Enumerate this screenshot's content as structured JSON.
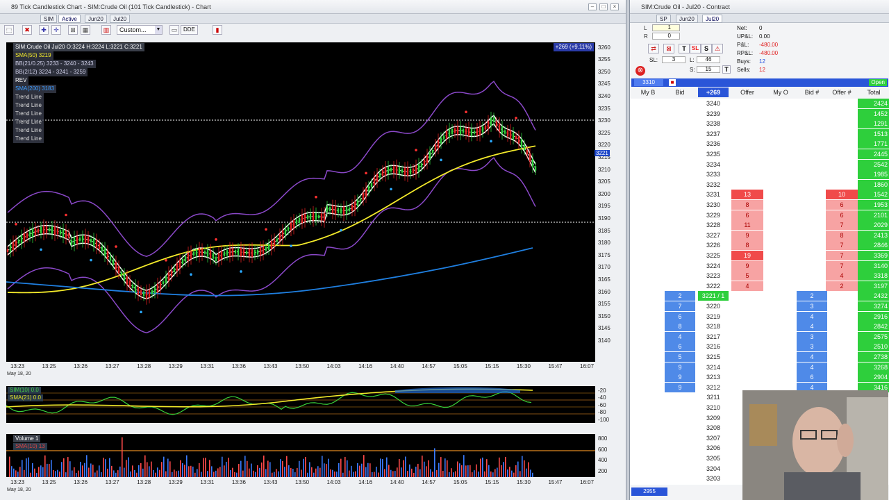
{
  "colors": {
    "bid_blue": "#5b8fe8",
    "offer_red": "#f04a4a",
    "total_green": "#2ecf3c",
    "sma_yellow": "#f3ea2a",
    "sma_blue": "#1f7fe0",
    "bb_purple": "#8a48c8"
  },
  "chart_window": {
    "title": "89 Tick Candlestick Chart - SIM:Crude Oil (101 Tick Candlestick) - Chart",
    "tabs": [
      "SIM",
      "Active",
      "Jun20",
      "Jul20"
    ],
    "toolbar_template": "Custom...",
    "toolbar_dde": "DDE",
    "header_ohlc": "SIM:Crude Oil Jul20 O:3224 H:3224 L:3221 C:3221",
    "change_badge": "+269 (+9.11%)",
    "last_price_tag": "3221",
    "indicators": [
      {
        "label": "SMA(50) 3219",
        "color": "#f3ea2a"
      },
      {
        "label": "BB(21/0.25) 3233 - 3240 - 3243",
        "color": "#cfcfe8"
      },
      {
        "label": "BB(2/12) 3224 - 3241 - 3259",
        "color": "#cfcfe8"
      },
      {
        "label": "REV",
        "color": "#ffffff"
      },
      {
        "label": "SMA(200) 3183",
        "color": "#3c9cff"
      },
      {
        "label": "Trend Line",
        "color": "#dddddd"
      },
      {
        "label": "Trend Line",
        "color": "#dddddd"
      },
      {
        "label": "Trend Line",
        "color": "#dddddd"
      },
      {
        "label": "Trend Line",
        "color": "#dddddd"
      },
      {
        "label": "Trend Line",
        "color": "#dddddd"
      },
      {
        "label": "Trend Line",
        "color": "#dddddd"
      }
    ],
    "price_axis": [
      "3260",
      "3255",
      "3250",
      "3245",
      "3240",
      "3235",
      "3230",
      "3225",
      "3220",
      "3215",
      "3210",
      "3205",
      "3200",
      "3195",
      "3190",
      "3185",
      "3180",
      "3175",
      "3170",
      "3165",
      "3160",
      "3155",
      "3150",
      "3145",
      "3140"
    ],
    "time_axis": [
      "13:23",
      "13:25",
      "13:26",
      "13:27",
      "13:28",
      "13:29",
      "13:31",
      "13:36",
      "13:43",
      "13:50",
      "14:03",
      "14:16",
      "14:40",
      "14:57",
      "15:05",
      "15:15",
      "15:30",
      "15:47",
      "16:07"
    ],
    "date_label": "May 18, 20",
    "osc_axis": [
      "-20",
      "-40",
      "-60",
      "-80",
      "-100"
    ],
    "osc_labels": [
      "SIM(10) 0.0",
      "SMA(21) 0.0"
    ],
    "volume_axis": [
      "800",
      "600",
      "400",
      "200"
    ],
    "volume_labels": [
      "Volume 1",
      "SMA(10) 13"
    ]
  },
  "dom_window": {
    "title": "SIM:Crude Oil - Jul20 - Contract",
    "tabs": [
      "SP",
      "Jun20",
      "Jul20"
    ],
    "net_label": "Net:",
    "net_value": "0",
    "upl_label": "UP&L:",
    "upl_value": "0.00",
    "pl_label": "P&L:",
    "pl_value": "-480.00",
    "rpl_label": "RP&L:",
    "rpl_value": "-480.00",
    "buys_label": "Buys:",
    "buys_value": "12",
    "sells_label": "Sells:",
    "sells_value": "12",
    "sl_label": "SL:",
    "sl_value": "3",
    "l_label": "L:",
    "l_value": "46",
    "s_label": "S:",
    "s_value": "15",
    "qty_value": "1",
    "qty2_value": "0",
    "account_box": "3310",
    "open_status": "Open",
    "bottom_box": "2955",
    "headers": {
      "my_b": "My B",
      "bid": "Bid",
      "change": "+269",
      "offer": "Offer",
      "my_o": "My O",
      "bid_n": "Bid #",
      "offer_n": "Offer #",
      "total": "Total"
    },
    "ladder": [
      {
        "price": "3240",
        "offer": "",
        "offer_n": "",
        "bid": "",
        "bid_n": "",
        "total": "2424"
      },
      {
        "price": "3239",
        "offer": "",
        "offer_n": "",
        "bid": "",
        "bid_n": "",
        "total": "1452"
      },
      {
        "price": "3238",
        "offer": "",
        "offer_n": "",
        "bid": "",
        "bid_n": "",
        "total": "1291"
      },
      {
        "price": "3237",
        "offer": "",
        "offer_n": "",
        "bid": "",
        "bid_n": "",
        "total": "1513"
      },
      {
        "price": "3236",
        "offer": "",
        "offer_n": "",
        "bid": "",
        "bid_n": "",
        "total": "1771"
      },
      {
        "price": "3235",
        "offer": "",
        "offer_n": "",
        "bid": "",
        "bid_n": "",
        "total": "2445"
      },
      {
        "price": "3234",
        "offer": "",
        "offer_n": "",
        "bid": "",
        "bid_n": "",
        "total": "2542"
      },
      {
        "price": "3233",
        "offer": "",
        "offer_n": "",
        "bid": "",
        "bid_n": "",
        "total": "1985"
      },
      {
        "price": "3232",
        "offer": "",
        "offer_n": "",
        "bid": "",
        "bid_n": "",
        "total": "1860"
      },
      {
        "price": "3231",
        "offer": "13",
        "offer_n": "10",
        "bid": "",
        "bid_n": "",
        "total": "1542"
      },
      {
        "price": "3230",
        "offer": "8",
        "offer_n": "6",
        "bid": "",
        "bid_n": "",
        "total": "1953"
      },
      {
        "price": "3229",
        "offer": "6",
        "offer_n": "6",
        "bid": "",
        "bid_n": "",
        "total": "2101"
      },
      {
        "price": "3228",
        "offer": "11",
        "offer_n": "7",
        "bid": "",
        "bid_n": "",
        "total": "2029"
      },
      {
        "price": "3227",
        "offer": "9",
        "offer_n": "8",
        "bid": "",
        "bid_n": "",
        "total": "2413"
      },
      {
        "price": "3226",
        "offer": "8",
        "offer_n": "7",
        "bid": "",
        "bid_n": "",
        "total": "2846"
      },
      {
        "price": "3225",
        "offer": "19",
        "offer_n": "7",
        "bid": "",
        "bid_n": "",
        "total": "3369"
      },
      {
        "price": "3224",
        "offer": "9",
        "offer_n": "7",
        "bid": "",
        "bid_n": "",
        "total": "3140"
      },
      {
        "price": "3223",
        "offer": "5",
        "offer_n": "4",
        "bid": "",
        "bid_n": "",
        "total": "3318"
      },
      {
        "price": "3222",
        "offer": "4",
        "offer_n": "2",
        "bid": "",
        "bid_n": "",
        "total": "3197"
      },
      {
        "price": "3221 / 1",
        "offer": "",
        "offer_n": "",
        "bid": "2",
        "bid_n": "2",
        "total": "2432",
        "last": true
      },
      {
        "price": "3220",
        "offer": "",
        "offer_n": "",
        "bid": "7",
        "bid_n": "3",
        "total": "3274"
      },
      {
        "price": "3219",
        "offer": "",
        "offer_n": "",
        "bid": "6",
        "bid_n": "4",
        "total": "2916"
      },
      {
        "price": "3218",
        "offer": "",
        "offer_n": "",
        "bid": "8",
        "bid_n": "4",
        "total": "2842"
      },
      {
        "price": "3217",
        "offer": "",
        "offer_n": "",
        "bid": "4",
        "bid_n": "3",
        "total": "2575"
      },
      {
        "price": "3216",
        "offer": "",
        "offer_n": "",
        "bid": "6",
        "bid_n": "3",
        "total": "2510"
      },
      {
        "price": "3215",
        "offer": "",
        "offer_n": "",
        "bid": "5",
        "bid_n": "4",
        "total": "2738"
      },
      {
        "price": "3214",
        "offer": "",
        "offer_n": "",
        "bid": "9",
        "bid_n": "4",
        "total": "3268"
      },
      {
        "price": "3213",
        "offer": "",
        "offer_n": "",
        "bid": "9",
        "bid_n": "6",
        "total": "2904"
      },
      {
        "price": "3212",
        "offer": "",
        "offer_n": "",
        "bid": "9",
        "bid_n": "4",
        "total": "3416"
      },
      {
        "price": "3211",
        "offer": "",
        "offer_n": "",
        "bid": "",
        "bid_n": "",
        "total": ""
      },
      {
        "price": "3210",
        "offer": "",
        "offer_n": "",
        "bid": "",
        "bid_n": "",
        "total": ""
      },
      {
        "price": "3209",
        "offer": "",
        "offer_n": "",
        "bid": "",
        "bid_n": "",
        "total": ""
      },
      {
        "price": "3208",
        "offer": "",
        "offer_n": "",
        "bid": "",
        "bid_n": "",
        "total": ""
      },
      {
        "price": "3207",
        "offer": "",
        "offer_n": "",
        "bid": "",
        "bid_n": "",
        "total": ""
      },
      {
        "price": "3206",
        "offer": "",
        "offer_n": "",
        "bid": "",
        "bid_n": "",
        "total": ""
      },
      {
        "price": "3205",
        "offer": "",
        "offer_n": "",
        "bid": "",
        "bid_n": "",
        "total": ""
      },
      {
        "price": "3204",
        "offer": "",
        "offer_n": "",
        "bid": "",
        "bid_n": "",
        "total": ""
      },
      {
        "price": "3203",
        "offer": "",
        "offer_n": "",
        "bid": "",
        "bid_n": "",
        "total": ""
      }
    ]
  }
}
